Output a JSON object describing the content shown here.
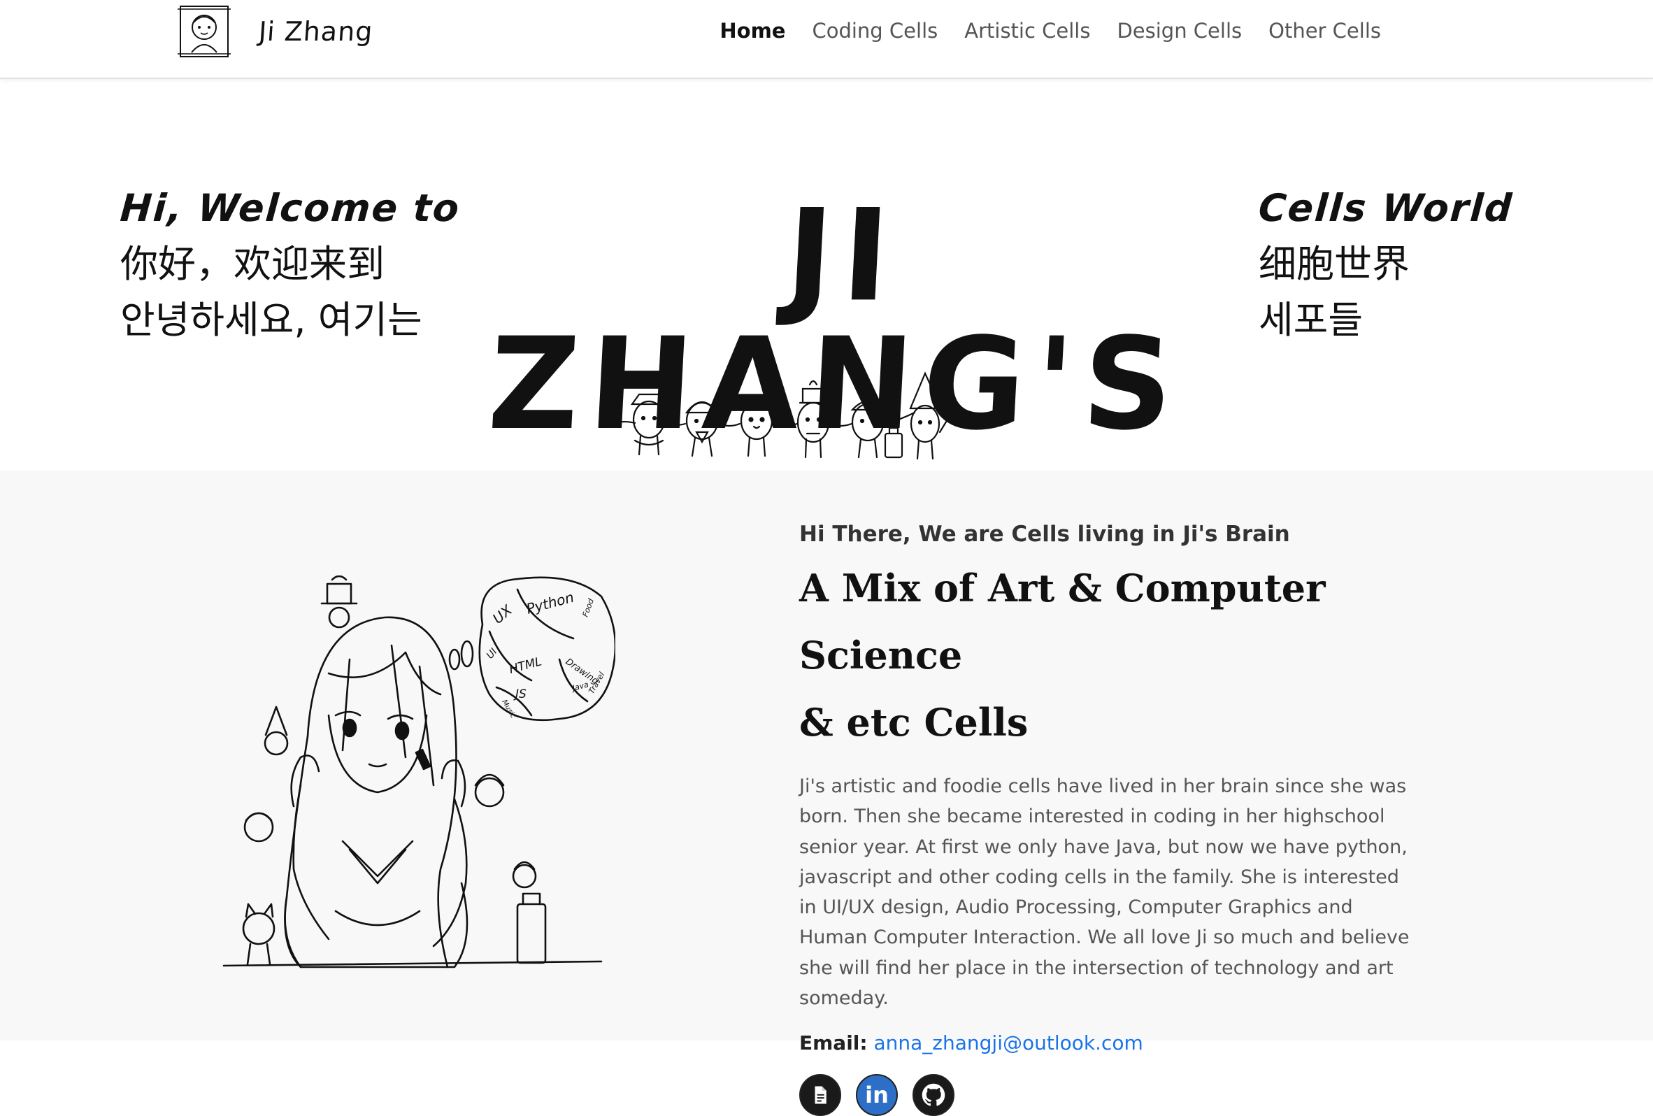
{
  "nav": {
    "brand_name": "Ji Zhang",
    "brand_logo_icon": "doodle-portrait-icon",
    "links": [
      {
        "label": "Home",
        "active": true
      },
      {
        "label": "Coding Cells",
        "active": false
      },
      {
        "label": "Artistic Cells",
        "active": false
      },
      {
        "label": "Design Cells",
        "active": false
      },
      {
        "label": "Other Cells",
        "active": false
      }
    ]
  },
  "hero": {
    "left_en": "Hi, Welcome to",
    "left_zh": "你好，欢迎来到",
    "left_ko": "안녕하세요, 여기는",
    "title": "JI ZHANG'S",
    "right_en": "Cells World",
    "right_zh": "细胞世界",
    "right_ko": "세포들"
  },
  "about": {
    "kicker": "Hi There, We are Cells living in Ji's Brain",
    "heading_line1": "A Mix of Art & Computer Science",
    "heading_line2": "& etc Cells",
    "paragraph": "Ji's artistic and foodie cells have lived in her brain since she was born. Then she became interested in coding in her highschool senior year. At first we only have Java, but now we have python, javascript and other coding cells in the family. She is interested in UI/UX design, Audio Processing, Computer Graphics and Human Computer Interaction. We all love Ji so much and believe she will find her place in the intersection of technology and art someday.",
    "email_label": "Email:",
    "email": "anna_zhangji@outlook.com",
    "socials": [
      {
        "icon": "document-icon",
        "color": "#1a1a1a"
      },
      {
        "icon": "linkedin-icon",
        "color": "#2d6fc7"
      },
      {
        "icon": "github-icon",
        "color": "#1a1a1a"
      }
    ],
    "illustration_bubble_words": [
      "UX",
      "UI",
      "Python",
      "HTML",
      "JS",
      "Drawing",
      "Food",
      "Java",
      "Travel",
      "Music"
    ]
  }
}
